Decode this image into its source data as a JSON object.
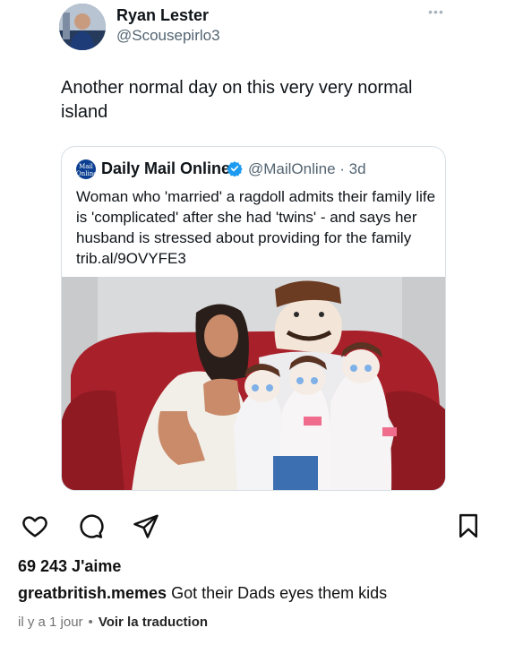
{
  "tweet": {
    "author_name": "Ryan Lester",
    "author_handle": "@Scousepirlo3",
    "more_icon": "more-horizontal-icon",
    "text": "Another normal day on this very very normal island",
    "quoted": {
      "logo_text": "Mail Online",
      "source_name": "Daily Mail Online",
      "handle_time": "@MailOnline · 3d",
      "text": "Woman who 'married' a ragdoll admits their family life is 'complicated' after she had 'twins' - and says her husband is stressed about providing for the family trib.al/9OVYFE3",
      "verified_icon": "verified-badge-icon"
    }
  },
  "instagram": {
    "actions": [
      "heart-icon",
      "comment-icon",
      "share-icon",
      "bookmark-icon"
    ],
    "likes": "69 243 J'aime",
    "caption_user": "greatbritish.memes",
    "caption_text": "Got their Dads eyes them kids",
    "time": "il y a 1 jour",
    "separator": "•",
    "translate": "Voir la traduction"
  },
  "colors": {
    "verified": "#1d9bf0",
    "handle_gray": "#536471",
    "daily_mail_blue": "#0c3f91",
    "sofa_red": "#a8202a"
  }
}
